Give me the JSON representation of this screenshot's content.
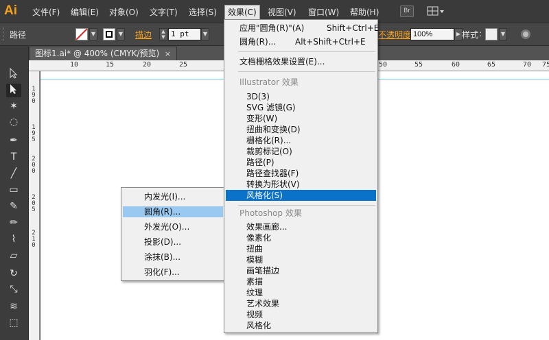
{
  "app": {
    "logo": "Ai"
  },
  "menubar": {
    "items": [
      "文件(F)",
      "编辑(E)",
      "对象(O)",
      "文字(T)",
      "选择(S)",
      "效果(C)",
      "视图(V)",
      "窗口(W)",
      "帮助(H)"
    ],
    "active": "效果(C)",
    "bridge_label": "Br"
  },
  "controlbar": {
    "selection_label": "路径",
    "stroke_label": "描边",
    "stroke_weight": "1 pt",
    "opacity_label": "不透明度",
    "opacity_value": "100%",
    "style_label": "样式"
  },
  "document": {
    "tab_title": "图标1.ai* @ 400% (CMYK/预览)",
    "close": "×"
  },
  "ruler": {
    "top_labels": [
      "10",
      "15",
      "20",
      "25",
      "50",
      "55",
      "60",
      "65",
      "70",
      "75"
    ],
    "left_labels": [
      "190",
      "195",
      "200",
      "205",
      "210"
    ]
  },
  "effect_menu": {
    "apply_last": {
      "label": "应用\"圆角(R)\"(A)",
      "shortcut": "Shift+Ctrl+E"
    },
    "last_effect": {
      "label": "圆角(R)...",
      "shortcut": "Alt+Shift+Ctrl+E"
    },
    "raster_settings": "文档栅格效果设置(E)...",
    "illustrator_header": "Illustrator 效果",
    "illustrator_items": [
      "3D(3)",
      "SVG 滤镜(G)",
      "变形(W)",
      "扭曲和变换(D)",
      "栅格化(R)...",
      "裁剪标记(O)",
      "路径(P)",
      "路径查找器(F)",
      "转换为形状(V)",
      "风格化(S)"
    ],
    "highlighted": "风格化(S)",
    "photoshop_header": "Photoshop 效果",
    "photoshop_items": [
      "效果画廊...",
      "像素化",
      "扭曲",
      "模糊",
      "画笔描边",
      "素描",
      "纹理",
      "艺术效果",
      "视频",
      "风格化"
    ]
  },
  "stylize_submenu": {
    "items": [
      "内发光(I)...",
      "圆角(R)...",
      "外发光(O)...",
      "投影(D)...",
      "涂抹(B)...",
      "羽化(F)..."
    ],
    "highlighted": "圆角(R)..."
  },
  "colors": {
    "accent_orange": "#f7a21b",
    "menu_highlight": "#0a73c9",
    "submenu_highlight": "#99c9f0",
    "guide": "#7fd6e6"
  }
}
